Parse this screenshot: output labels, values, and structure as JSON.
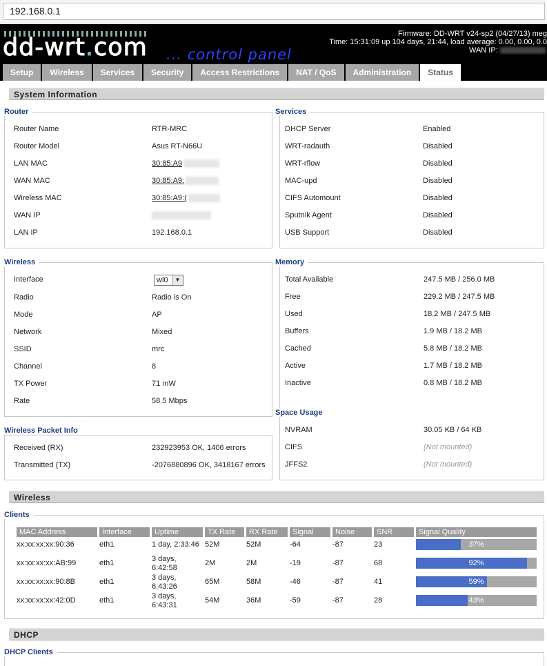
{
  "browser": {
    "url": "192.168.0.1"
  },
  "header": {
    "logo": "dd-wrt.com",
    "tagline": "... control panel",
    "firmware": "Firmware: DD-WRT v24-sp2 (04/27/13) meg",
    "time": "Time: 15:31:09 up 104 days, 21:44, load average: 0.00, 0.00, 0.0",
    "wan_ip_label": "WAN IP:"
  },
  "tabs": [
    "Setup",
    "Wireless",
    "Services",
    "Security",
    "Access Restrictions",
    "NAT / QoS",
    "Administration",
    "Status"
  ],
  "system_info": {
    "title": "System Information",
    "router": {
      "legend": "Router",
      "rows": [
        {
          "label": "Router Name",
          "value": "RTR-MRC"
        },
        {
          "label": "Router Model",
          "value": "Asus RT-N66U"
        },
        {
          "label": "LAN MAC",
          "value": "30:85:A9"
        },
        {
          "label": "WAN MAC",
          "value": "30:85:A9:"
        },
        {
          "label": "Wireless MAC",
          "value": "30:85:A9:("
        },
        {
          "label": "WAN IP",
          "value": ""
        },
        {
          "label": "LAN IP",
          "value": "192.168.0.1"
        }
      ]
    },
    "services": {
      "legend": "Services",
      "rows": [
        {
          "label": "DHCP Server",
          "value": "Enabled"
        },
        {
          "label": "WRT-radauth",
          "value": "Disabled"
        },
        {
          "label": "WRT-rflow",
          "value": "Disabled"
        },
        {
          "label": "MAC-upd",
          "value": "Disabled"
        },
        {
          "label": "CIFS Automount",
          "value": "Disabled"
        },
        {
          "label": "Sputnik Agent",
          "value": "Disabled"
        },
        {
          "label": "USB Support",
          "value": "Disabled"
        }
      ]
    },
    "wireless": {
      "legend": "Wireless",
      "interface_label": "Interface",
      "interface_value": "wl0",
      "rows": [
        {
          "label": "Radio",
          "value": "Radio is On"
        },
        {
          "label": "Mode",
          "value": "AP"
        },
        {
          "label": "Network",
          "value": "Mixed"
        },
        {
          "label": "SSID",
          "value": "mrc"
        },
        {
          "label": "Channel",
          "value": "8"
        },
        {
          "label": "TX Power",
          "value": "71 mW"
        },
        {
          "label": "Rate",
          "value": "58.5 Mbps"
        }
      ]
    },
    "memory": {
      "legend": "Memory",
      "rows": [
        {
          "label": "Total Available",
          "value": "247.5 MB / 256.0 MB"
        },
        {
          "label": "Free",
          "value": "229.2 MB / 247.5 MB"
        },
        {
          "label": "Used",
          "value": "18.2 MB / 247.5 MB"
        },
        {
          "label": "Buffers",
          "value": "1.9 MB / 18.2 MB"
        },
        {
          "label": "Cached",
          "value": "5.8 MB / 18.2 MB"
        },
        {
          "label": "Active",
          "value": "1.7 MB / 18.2 MB"
        },
        {
          "label": "Inactive",
          "value": "0.8 MB / 18.2 MB"
        }
      ]
    },
    "packet_info": {
      "legend": "Wireless Packet Info",
      "rows": [
        {
          "label": "Received (RX)",
          "value": "232923953 OK, 1406 errors"
        },
        {
          "label": "Transmitted (TX)",
          "value": "-2076880896 OK, 3418167 errors"
        }
      ]
    },
    "space_usage": {
      "legend": "Space Usage",
      "rows": [
        {
          "label": "NVRAM",
          "value": "30.05 KB / 64 KB"
        },
        {
          "label": "CIFS",
          "value": "(Not mounted)"
        },
        {
          "label": "JFFS2",
          "value": "(Not mounted)"
        }
      ]
    }
  },
  "wireless_section": {
    "title": "Wireless",
    "clients_legend": "Clients",
    "columns": [
      "MAC Address",
      "Interface",
      "Uptime",
      "TX Rate",
      "RX Rate",
      "Signal",
      "Noise",
      "SNR",
      "Signal Quality"
    ],
    "clients": [
      {
        "mac": "xx:xx:xx:xx:90:36",
        "iface": "eth1",
        "uptime1": "1 day, 2:33:46",
        "uptime2": "",
        "tx": "52M",
        "rx": "52M",
        "signal": "-64",
        "noise": "-87",
        "snr": "23",
        "quality": 37,
        "quality_label": "37%"
      },
      {
        "mac": "xx:xx:xx:xx:AB:99",
        "iface": "eth1",
        "uptime1": "3 days,",
        "uptime2": "6:42:58",
        "tx": "2M",
        "rx": "2M",
        "signal": "-19",
        "noise": "-87",
        "snr": "68",
        "quality": 92,
        "quality_label": "92%"
      },
      {
        "mac": "xx:xx:xx:xx:90:8B",
        "iface": "eth1",
        "uptime1": "3 days,",
        "uptime2": "6:43:26",
        "tx": "65M",
        "rx": "58M",
        "signal": "-46",
        "noise": "-87",
        "snr": "41",
        "quality": 59,
        "quality_label": "59%"
      },
      {
        "mac": "xx:xx:xx:xx:42:0D",
        "iface": "eth1",
        "uptime1": "3 days,",
        "uptime2": "6:43:31",
        "tx": "54M",
        "rx": "36M",
        "signal": "-59",
        "noise": "-87",
        "snr": "28",
        "quality": 43,
        "quality_label": "43%"
      }
    ]
  },
  "dhcp_section": {
    "title": "DHCP",
    "clients_legend": "DHCP Clients"
  }
}
